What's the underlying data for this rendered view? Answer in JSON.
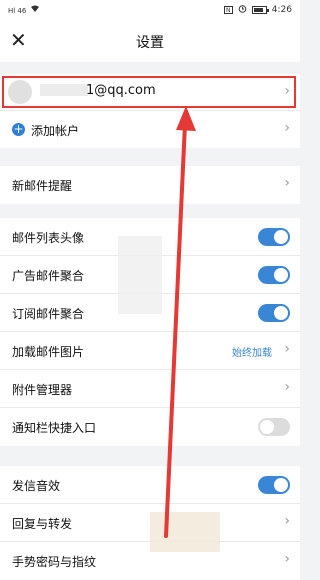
{
  "status_bar": {
    "signal": "Hl 46",
    "time": "4:26"
  },
  "header": {
    "title": "设置",
    "close_glyph": "✕"
  },
  "account": {
    "email": "1@qq.com"
  },
  "add_account": {
    "label": "添加帐户"
  },
  "rows": {
    "new_mail_alert": "新邮件提醒",
    "list_avatar": "邮件列表头像",
    "ad_aggregate": "广告邮件聚合",
    "subscribe_aggregate": "订阅邮件聚合",
    "load_images": "加载邮件图片",
    "load_images_value": "始终加载",
    "attachment_manager": "附件管理器",
    "notification_shortcut": "通知栏快捷入口",
    "send_sound": "发信音效",
    "reply_forward": "回复与转发",
    "gesture_password": "手势密码与指纹"
  },
  "toggles": {
    "list_avatar": true,
    "ad_aggregate": true,
    "subscribe_aggregate": true,
    "notification_shortcut": false,
    "send_sound": true
  },
  "colors": {
    "accent": "#3a86d6",
    "highlight": "#e53935"
  }
}
